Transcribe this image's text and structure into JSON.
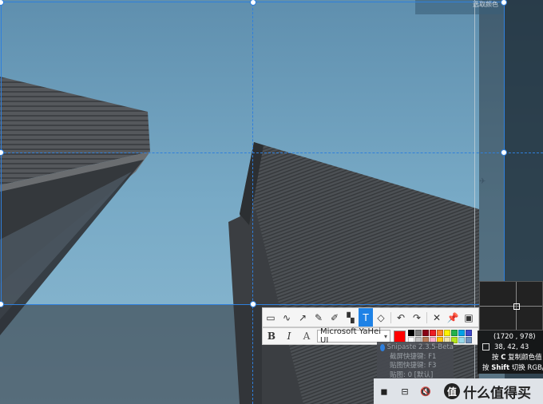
{
  "toolbar": {
    "tools": [
      {
        "name": "rectangle-tool",
        "glyph": "▭"
      },
      {
        "name": "curve-tool",
        "glyph": "∿"
      },
      {
        "name": "arrow-tool",
        "glyph": "↗"
      },
      {
        "name": "pencil-tool",
        "glyph": "✎"
      },
      {
        "name": "marker-tool",
        "glyph": "✐"
      },
      {
        "name": "mosaic-tool",
        "glyph": "▚"
      },
      {
        "name": "text-tool",
        "glyph": "T",
        "active": true
      },
      {
        "name": "eraser-tool",
        "glyph": "◇"
      }
    ],
    "actions": [
      {
        "name": "undo-button",
        "glyph": "↶"
      },
      {
        "name": "redo-button",
        "glyph": "↷"
      },
      {
        "name": "close-button",
        "glyph": "✕"
      },
      {
        "name": "pin-button",
        "glyph": "📌"
      },
      {
        "name": "save-button",
        "glyph": "▣"
      }
    ]
  },
  "textbar": {
    "bold": "B",
    "italic": "I",
    "outline": "A",
    "font": "Microsoft YaHei UI",
    "current_color": "#ff0000",
    "palette": [
      "#000000",
      "#7f7f7f",
      "#880015",
      "#ed1c24",
      "#ff7f27",
      "#fff200",
      "#22b14c",
      "#00a2e8",
      "#3f48cc",
      "#ffffff",
      "#c3c3c3",
      "#b97a57",
      "#ffaec9",
      "#ffc90e",
      "#efe4b0",
      "#b5e61d",
      "#99d9ea",
      "#7092be"
    ]
  },
  "tray_menu": {
    "items": [
      "Snipaste 2.3.5-Beta",
      "截屏快捷键: F1",
      "贴图快捷键: F3",
      "贴图: 0 [默认]"
    ]
  },
  "magnifier": {
    "coords": "(1720 , 978)",
    "rgb": "38,  42,  43",
    "hint_c_prefix": "按",
    "hint_c_key": "C",
    "hint_c_text": "复制颜色值",
    "hint_shift_prefix": "按",
    "hint_shift_key": "Shift",
    "hint_shift_text": "切换 RGB/HE"
  },
  "top_hint": "选取颜色",
  "watermark": {
    "logo": "值",
    "text": "什么值得买"
  }
}
